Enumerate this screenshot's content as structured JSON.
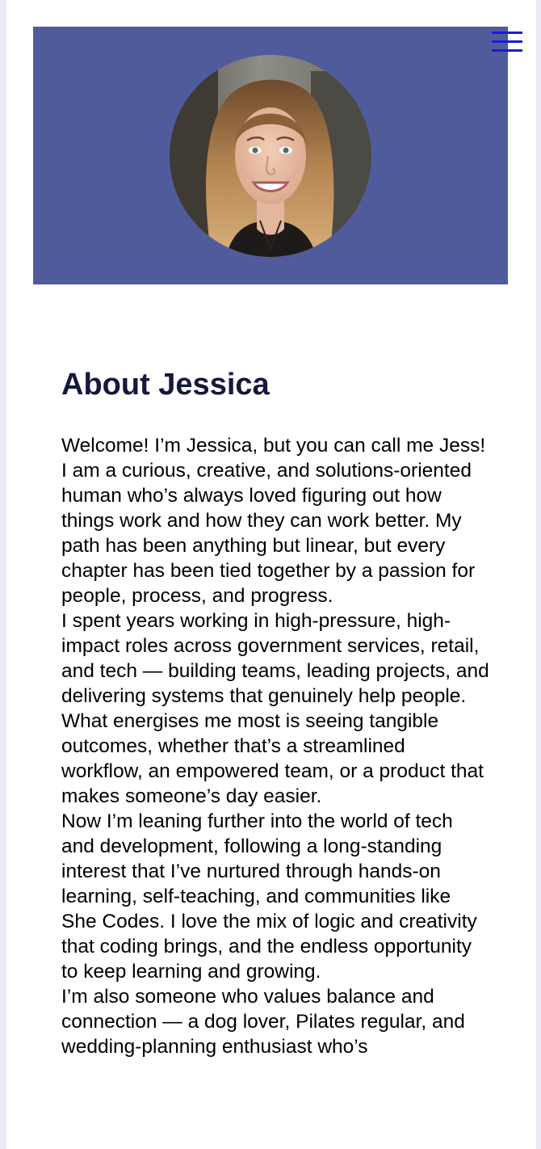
{
  "hero": {
    "background_color": "#505b9c",
    "profile_photo_alt": "Photo of Jessica"
  },
  "menu": {
    "icon": "hamburger-menu-icon",
    "icon_color": "#1b1bd9"
  },
  "about": {
    "heading": "About Jessica",
    "paragraphs": [
      "Welcome! I’m Jessica, but you can call me Jess!",
      "I am a curious, creative, and solutions-oriented human who’s always loved figuring out how things work and how they can work better. My path has been anything but linear, but every chapter has been tied together by a passion for people, process, and progress.",
      "I spent years working in high-pressure, high-impact roles across government services, retail, and tech — building teams, leading projects, and delivering systems that genuinely help people. What energises me most is seeing tangible outcomes, whether that’s a streamlined workflow, an empowered team, or a product that makes someone’s day easier.",
      "Now I’m leaning further into the world of tech and development, following a long-standing interest that I’ve nurtured through hands-on learning, self-teaching, and communities like She Codes. I love the mix of logic and creativity that coding brings, and the endless opportunity to keep learning and growing.",
      "I’m also someone who values balance and connection — a dog lover, Pilates regular, and wedding-planning enthusiast who’s"
    ]
  }
}
